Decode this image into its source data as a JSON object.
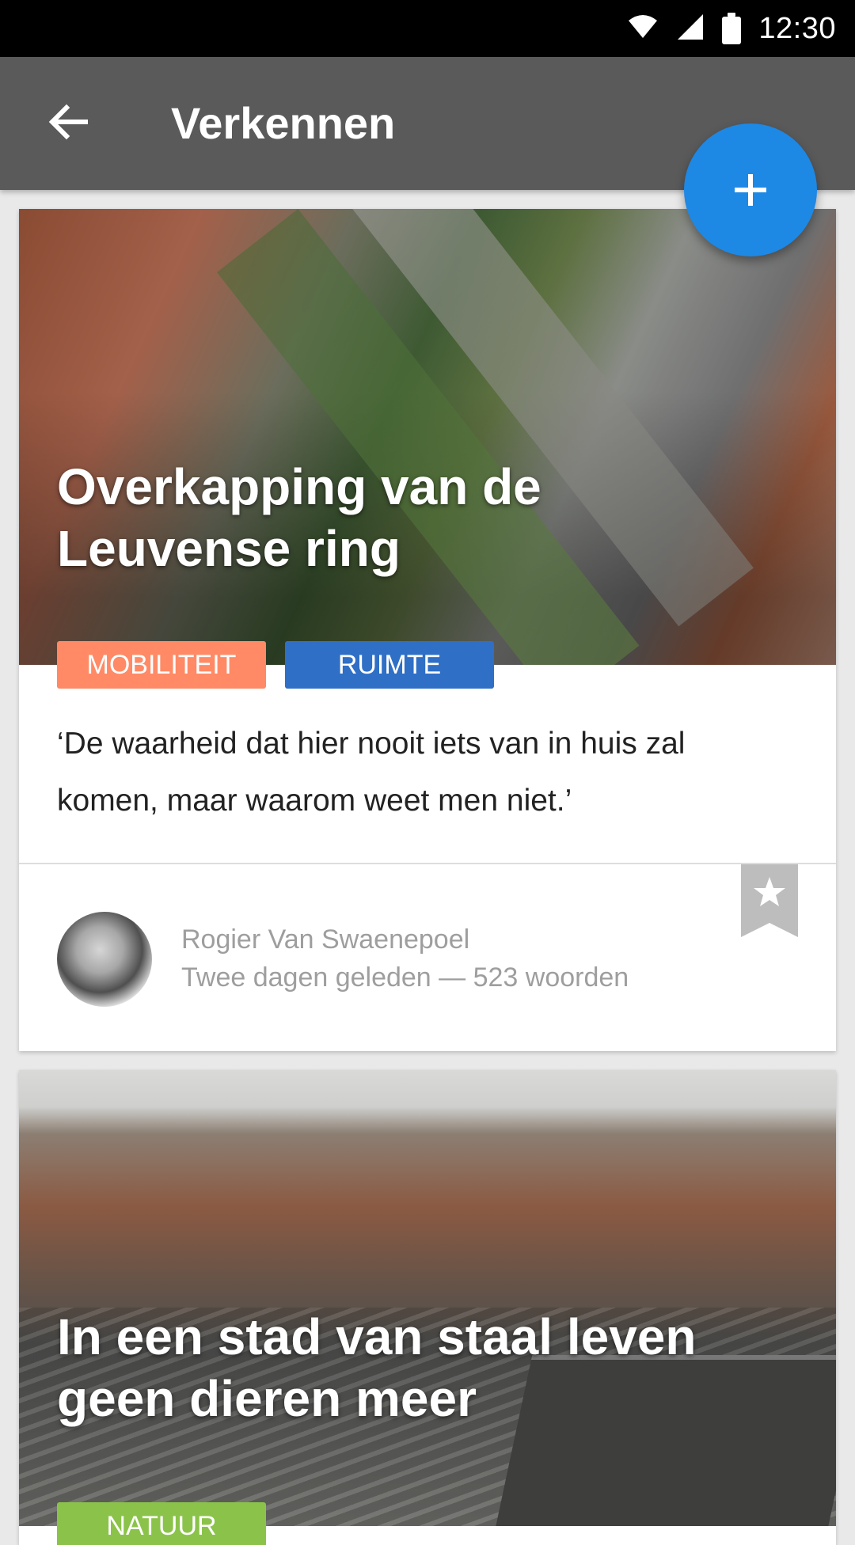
{
  "status_bar": {
    "time": "12:30",
    "icons": [
      "wifi-icon",
      "signal-icon",
      "battery-icon"
    ]
  },
  "app_bar": {
    "title": "Verkennen",
    "back_icon": "arrow-left-icon"
  },
  "fab": {
    "icon": "plus-icon",
    "color": "#1e88e5"
  },
  "cards": [
    {
      "title": "Overkapping van de Leuvense ring",
      "tags": [
        {
          "label": "MOBILITEIT",
          "color": "#ff8a65"
        },
        {
          "label": "RUIMTE",
          "color": "#2f6fc6"
        }
      ],
      "quote": "‘De waarheid dat hier nooit iets van in huis zal komen, maar waarom weet men niet.’",
      "author": "Rogier Van Swaenepoel",
      "meta": "Twee dagen geleden — 523 woorden",
      "bookmark_icon": "star-bookmark-icon"
    },
    {
      "title": "In een stad van staal leven geen dieren meer",
      "tags": [
        {
          "label": "NATUUR",
          "color": "#8bc34a"
        }
      ]
    }
  ],
  "colors": {
    "status_bar": "#000000",
    "app_bar": "#5a5a5a",
    "background": "#e9e9e9"
  }
}
